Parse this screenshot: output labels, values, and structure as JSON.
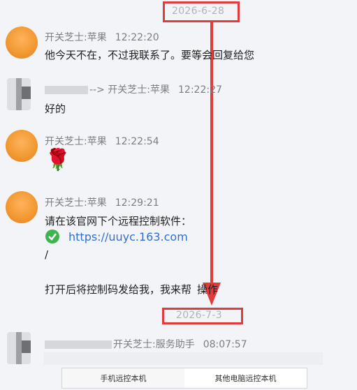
{
  "dates": [
    "2026-6-28",
    "2026-7-3"
  ],
  "messages": [
    {
      "sender": "开关芝士:苹果",
      "time": "12:22:20",
      "text": "他今天不在，不过我联系了。要等会回复给您"
    },
    {
      "sender_prefix": "-->",
      "sender": "开关芝士:苹果",
      "time": "12:22:27",
      "text": "好的"
    },
    {
      "sender": "开关芝士:苹果",
      "time": "12:22:54",
      "emoji": "🌹"
    },
    {
      "sender": "开关芝士:苹果",
      "time": "12:29:21",
      "line1": "请在该官网下个远程控制软件：",
      "link": "https://uuyc.163.com",
      "line3": "/",
      "line4_a": "打开后将控制码发给我，我来帮",
      "line4_b": "操作"
    },
    {
      "sender": "开关芝士:服务助手",
      "time": "08:07:57"
    }
  ],
  "bottom_tabs": [
    "手机远控本机",
    "其他电脑远控本机"
  ],
  "colors": {
    "highlight": "#e23b3b",
    "link": "#2f6fd6",
    "check": "#3fb34f"
  }
}
